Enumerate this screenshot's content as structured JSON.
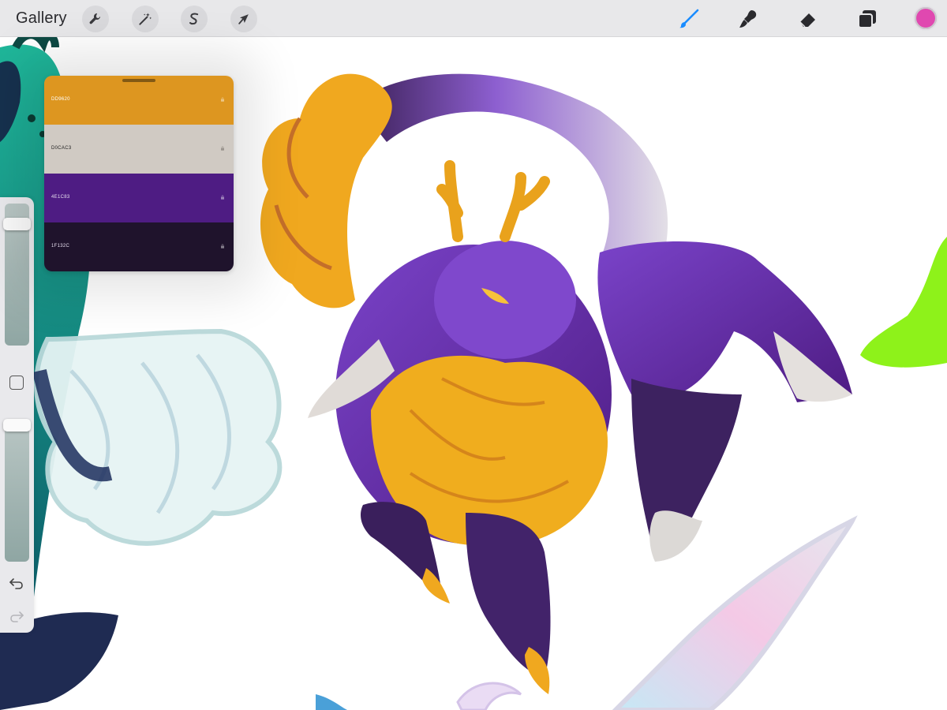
{
  "toolbar": {
    "gallery_label": "Gallery",
    "left_tools": [
      {
        "name": "actions",
        "icon": "wrench-icon"
      },
      {
        "name": "adjustments",
        "icon": "magic-wand-icon"
      },
      {
        "name": "selection",
        "icon": "selection-s-icon"
      },
      {
        "name": "transform",
        "icon": "arrow-cursor-icon"
      }
    ],
    "right_tools": [
      {
        "name": "brush",
        "icon": "brush-icon",
        "active": true,
        "color": "#1a8cff"
      },
      {
        "name": "smudge",
        "icon": "smudge-icon"
      },
      {
        "name": "eraser",
        "icon": "eraser-icon"
      },
      {
        "name": "layers",
        "icon": "layers-icon"
      }
    ],
    "current_color": "#e048b0"
  },
  "palette": {
    "swatches": [
      {
        "hex": "DD9620",
        "color": "#DD9620",
        "text_color": "#ffffff"
      },
      {
        "hex": "D0CAC3",
        "color": "#D0CAC3",
        "text_color": "#222222"
      },
      {
        "hex": "4E1C83",
        "color": "#4E1C83",
        "text_color": "#e8e0f0"
      },
      {
        "hex": "1F132C",
        "color": "#1F132C",
        "text_color": "#e8e0f0"
      }
    ]
  },
  "sidebar": {
    "brush_size_level": 0.08,
    "opacity_level": 0.0,
    "undo_icon": "undo-arrow-icon",
    "redo_icon": "redo-arrow-icon"
  }
}
